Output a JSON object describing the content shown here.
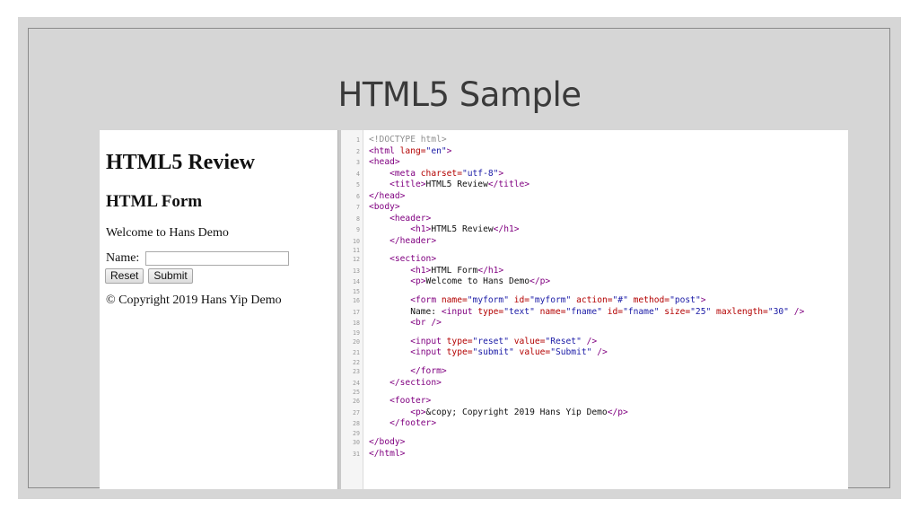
{
  "slide": {
    "title": "HTML5 Sample"
  },
  "preview": {
    "heading": "HTML5 Review",
    "subheading": "HTML Form",
    "welcome": "Welcome to Hans Demo",
    "name_label": "Name:",
    "name_value": "",
    "reset_label": "Reset",
    "submit_label": "Submit",
    "copyright": "© Copyright 2019 Hans Yip Demo"
  },
  "editor": {
    "lines": [
      {
        "n": "1",
        "segs": [
          [
            "doctype",
            "<!DOCTYPE html>"
          ]
        ]
      },
      {
        "n": "2",
        "segs": [
          [
            "tag",
            "<html "
          ],
          [
            "attr",
            "lang="
          ],
          [
            "val",
            "\"en\""
          ],
          [
            "tag",
            ">"
          ]
        ]
      },
      {
        "n": "3",
        "segs": [
          [
            "tag",
            "<head>"
          ]
        ]
      },
      {
        "n": "4",
        "segs": [
          [
            "text",
            "    "
          ],
          [
            "tag",
            "<meta "
          ],
          [
            "attr",
            "charset="
          ],
          [
            "val",
            "\"utf-8\""
          ],
          [
            "tag",
            ">"
          ]
        ]
      },
      {
        "n": "5",
        "segs": [
          [
            "text",
            "    "
          ],
          [
            "tag",
            "<title>"
          ],
          [
            "text",
            "HTML5 Review"
          ],
          [
            "tag",
            "</title>"
          ]
        ]
      },
      {
        "n": "6",
        "segs": [
          [
            "tag",
            "</head>"
          ]
        ]
      },
      {
        "n": "7",
        "segs": [
          [
            "tag",
            "<body>"
          ]
        ]
      },
      {
        "n": "8",
        "segs": [
          [
            "text",
            "    "
          ],
          [
            "tag",
            "<header>"
          ]
        ]
      },
      {
        "n": "9",
        "segs": [
          [
            "text",
            "        "
          ],
          [
            "tag",
            "<h1>"
          ],
          [
            "text",
            "HTML5 Review"
          ],
          [
            "tag",
            "</h1>"
          ]
        ]
      },
      {
        "n": "10",
        "segs": [
          [
            "text",
            "    "
          ],
          [
            "tag",
            "</header>"
          ]
        ]
      },
      {
        "n": "11",
        "short": true,
        "segs": []
      },
      {
        "n": "12",
        "segs": [
          [
            "text",
            "    "
          ],
          [
            "tag",
            "<section>"
          ]
        ]
      },
      {
        "n": "13",
        "segs": [
          [
            "text",
            "        "
          ],
          [
            "tag",
            "<h1>"
          ],
          [
            "text",
            "HTML Form"
          ],
          [
            "tag",
            "</h1>"
          ]
        ]
      },
      {
        "n": "14",
        "segs": [
          [
            "text",
            "        "
          ],
          [
            "tag",
            "<p>"
          ],
          [
            "text",
            "Welcome to Hans Demo"
          ],
          [
            "tag",
            "</p>"
          ]
        ]
      },
      {
        "n": "15",
        "short": true,
        "segs": []
      },
      {
        "n": "16",
        "segs": [
          [
            "text",
            "        "
          ],
          [
            "tag",
            "<form "
          ],
          [
            "attr",
            "name="
          ],
          [
            "val",
            "\"myform\""
          ],
          [
            "attr",
            " id="
          ],
          [
            "val",
            "\"myform\""
          ],
          [
            "attr",
            " action="
          ],
          [
            "val",
            "\"#\""
          ],
          [
            "attr",
            " method="
          ],
          [
            "val",
            "\"post\""
          ],
          [
            "tag",
            ">"
          ]
        ]
      },
      {
        "n": "17",
        "segs": [
          [
            "text",
            "        Name: "
          ],
          [
            "tag",
            "<input "
          ],
          [
            "attr",
            "type="
          ],
          [
            "val",
            "\"text\""
          ],
          [
            "attr",
            " name="
          ],
          [
            "val",
            "\"fname\""
          ],
          [
            "attr",
            " id="
          ],
          [
            "val",
            "\"fname\""
          ],
          [
            "attr",
            " size="
          ],
          [
            "val",
            "\"25\""
          ],
          [
            "attr",
            " maxlength="
          ],
          [
            "val",
            "\"30\""
          ],
          [
            "tag",
            " />"
          ]
        ]
      },
      {
        "n": "18",
        "segs": [
          [
            "text",
            "        "
          ],
          [
            "tag",
            "<br />"
          ]
        ]
      },
      {
        "n": "19",
        "short": true,
        "segs": []
      },
      {
        "n": "20",
        "segs": [
          [
            "text",
            "        "
          ],
          [
            "tag",
            "<input "
          ],
          [
            "attr",
            "type="
          ],
          [
            "val",
            "\"reset\""
          ],
          [
            "attr",
            " value="
          ],
          [
            "val",
            "\"Reset\""
          ],
          [
            "tag",
            " />"
          ]
        ]
      },
      {
        "n": "21",
        "segs": [
          [
            "text",
            "        "
          ],
          [
            "tag",
            "<input "
          ],
          [
            "attr",
            "type="
          ],
          [
            "val",
            "\"submit\""
          ],
          [
            "attr",
            " value="
          ],
          [
            "val",
            "\"Submit\""
          ],
          [
            "tag",
            " />"
          ]
        ]
      },
      {
        "n": "22",
        "short": true,
        "segs": []
      },
      {
        "n": "23",
        "segs": [
          [
            "text",
            "        "
          ],
          [
            "tag",
            "</form>"
          ]
        ]
      },
      {
        "n": "24",
        "segs": [
          [
            "text",
            "    "
          ],
          [
            "tag",
            "</section>"
          ]
        ]
      },
      {
        "n": "25",
        "short": true,
        "segs": []
      },
      {
        "n": "26",
        "segs": [
          [
            "text",
            "    "
          ],
          [
            "tag",
            "<footer>"
          ]
        ]
      },
      {
        "n": "27",
        "segs": [
          [
            "text",
            "        "
          ],
          [
            "tag",
            "<p>"
          ],
          [
            "text",
            "&copy; Copyright 2019 Hans Yip Demo"
          ],
          [
            "tag",
            "</p>"
          ]
        ]
      },
      {
        "n": "28",
        "segs": [
          [
            "text",
            "    "
          ],
          [
            "tag",
            "</footer>"
          ]
        ]
      },
      {
        "n": "29",
        "short": true,
        "segs": []
      },
      {
        "n": "30",
        "segs": [
          [
            "tag",
            "</body>"
          ]
        ]
      },
      {
        "n": "31",
        "segs": [
          [
            "tag",
            "</html>"
          ]
        ]
      }
    ]
  }
}
